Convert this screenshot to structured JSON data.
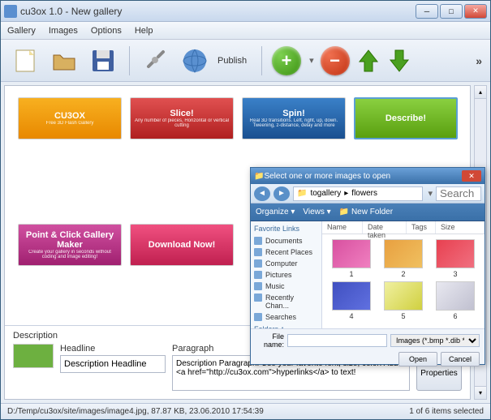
{
  "window": {
    "title": "cu3ox 1.0 - New gallery"
  },
  "menubar": [
    "Gallery",
    "Images",
    "Options",
    "Help"
  ],
  "toolbar": {
    "publish_label": "Publish"
  },
  "gallery": {
    "thumbs": [
      {
        "name": "CU3OX",
        "sub": "Free 3D Flash Gallery",
        "bg": "linear-gradient(#f8b020,#e88800)"
      },
      {
        "name": "Slice!",
        "sub": "Any number of pieces, Horizontal or vertical cutting",
        "bg": "linear-gradient(#e05050,#b02020)"
      },
      {
        "name": "Spin!",
        "sub": "Real 3D transitions. Left, right, up, down. Tweening, z-distance, delay and more",
        "bg": "linear-gradient(#3a80c8,#1a5090)"
      },
      {
        "name": "Describe!",
        "sub": "",
        "bg": "linear-gradient(#8ad040,#5aa010)",
        "selected": true
      },
      {
        "name": "Point & Click Gallery Maker",
        "sub": "Create your gallery in seconds without coding and image editing!",
        "bg": "linear-gradient(#d050a0,#a02070)"
      },
      {
        "name": "Download Now!",
        "sub": "",
        "bg": "linear-gradient(#f05080,#c02050)"
      }
    ]
  },
  "description": {
    "section_label": "Description",
    "headline_label": "Headline",
    "paragraph_label": "Paragraph",
    "headline_value": "Description Headline",
    "paragraph_value": "Description Paragraph. Use your favorite font, size, color! Add <a href=\"http://cu3ox.com\">hyperlinks</a> to text!",
    "properties_btn": "Properties"
  },
  "statusbar": {
    "left": "D:/Temp/cu3ox/site/images/image4.jpg, 87.87 KB, 23.06.2010 17:54:39",
    "right": "1 of 6 items selected"
  },
  "file_dialog": {
    "title": "Select one or more images to open",
    "path_parts": [
      "togallery",
      "flowers"
    ],
    "search_placeholder": "Search",
    "tools": {
      "organize": "Organize",
      "views": "Views",
      "newfolder": "New Folder"
    },
    "side_title": "Favorite Links",
    "side_items": [
      "Documents",
      "Recent Places",
      "Computer",
      "Pictures",
      "Music",
      "Recently Chan...",
      "Searches"
    ],
    "folders_label": "Folders",
    "headers": [
      "Name",
      "Date taken",
      "Tags",
      "Size"
    ],
    "files": [
      {
        "label": "1",
        "bg": "linear-gradient(135deg,#d850a0,#f080c0)"
      },
      {
        "label": "2",
        "bg": "linear-gradient(135deg,#e8a040,#f0c060)"
      },
      {
        "label": "3",
        "bg": "linear-gradient(135deg,#e84050,#f07080)"
      },
      {
        "label": "4",
        "bg": "linear-gradient(135deg,#4050c0,#6070e0)"
      },
      {
        "label": "5",
        "bg": "linear-gradient(135deg,#f0f0a0,#d0d040)"
      },
      {
        "label": "6",
        "bg": "linear-gradient(135deg,#e8e8f0,#c0c0d0)"
      }
    ],
    "filename_label": "File name:",
    "filename_value": "",
    "filter": "Images (*.bmp *.dib *.rle *.jpg ",
    "open_btn": "Open",
    "cancel_btn": "Cancel"
  }
}
